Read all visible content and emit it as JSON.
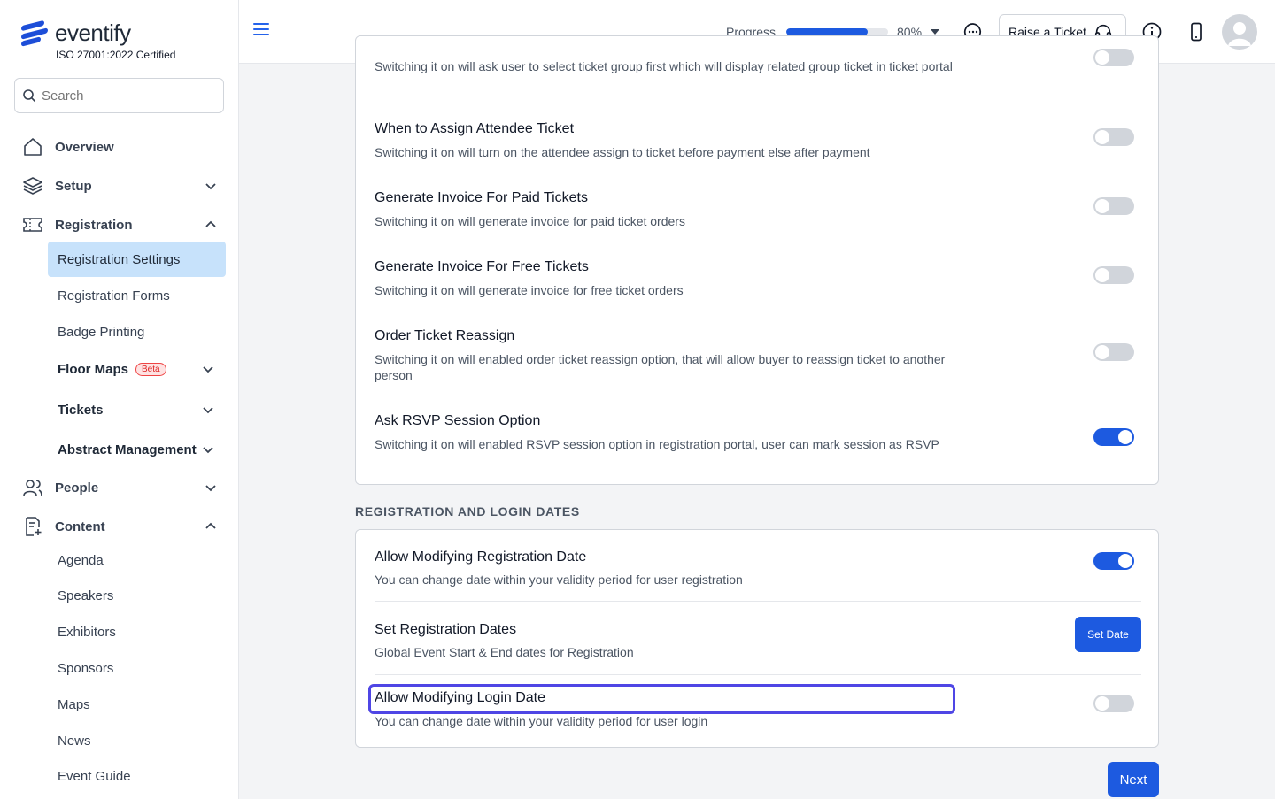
{
  "brand": {
    "name": "eventify",
    "certification": "ISO 27001:2022 Certified"
  },
  "search": {
    "placeholder": "Search"
  },
  "sidebar": {
    "overview": "Overview",
    "setup": "Setup",
    "registration": "Registration",
    "registration_items": [
      "Registration Settings",
      "Registration Forms",
      "Badge Printing"
    ],
    "floor_maps": "Floor Maps",
    "beta": "Beta",
    "tickets": "Tickets",
    "abstract": "Abstract Management",
    "people": "People",
    "content": "Content",
    "content_items": [
      "Agenda",
      "Speakers",
      "Exhibitors",
      "Sponsors",
      "Maps",
      "News",
      "Event Guide"
    ]
  },
  "header": {
    "progress_label": "Progress",
    "progress_value": 80,
    "progress_text": "80%",
    "raise_ticket": "Raise a Ticket"
  },
  "settings_top": {
    "partial_desc": "Switching it on will ask user to select ticket group first which will display related group ticket in ticket portal",
    "rows": [
      {
        "title": "When to Assign Attendee Ticket",
        "desc": "Switching it on will turn on the attendee assign to ticket before payment else after payment",
        "on": false
      },
      {
        "title": "Generate Invoice For Paid Tickets",
        "desc": "Switching it on will generate invoice for paid ticket orders",
        "on": false
      },
      {
        "title": "Generate Invoice For Free Tickets",
        "desc": "Switching it on will generate invoice for free ticket orders",
        "on": false
      },
      {
        "title": "Order Ticket Reassign",
        "desc": "Switching it on will enabled order ticket reassign option, that will allow buyer to reassign ticket to another person",
        "on": false
      },
      {
        "title": "Ask RSVP Session Option",
        "desc": "Switching it on will enabled RSVP session option in registration portal, user can mark session as RSVP",
        "on": true
      }
    ]
  },
  "dates_section": {
    "title": "REGISTRATION AND LOGIN DATES",
    "rows": [
      {
        "title": "Allow Modifying Registration Date",
        "desc": "You can change date within your validity period for user registration",
        "on": true
      },
      {
        "title": "Set Registration Dates",
        "desc": "Global Event Start & End dates for Registration",
        "button": "Set Date"
      },
      {
        "title": "Allow Modifying Login Date",
        "desc": "You can change date within your validity period for user login",
        "on": false
      }
    ]
  },
  "next_button": "Next",
  "colors": {
    "primary": "#1d5ae0",
    "active_nav": "#c7e2fb",
    "focus": "#4f46e5"
  }
}
